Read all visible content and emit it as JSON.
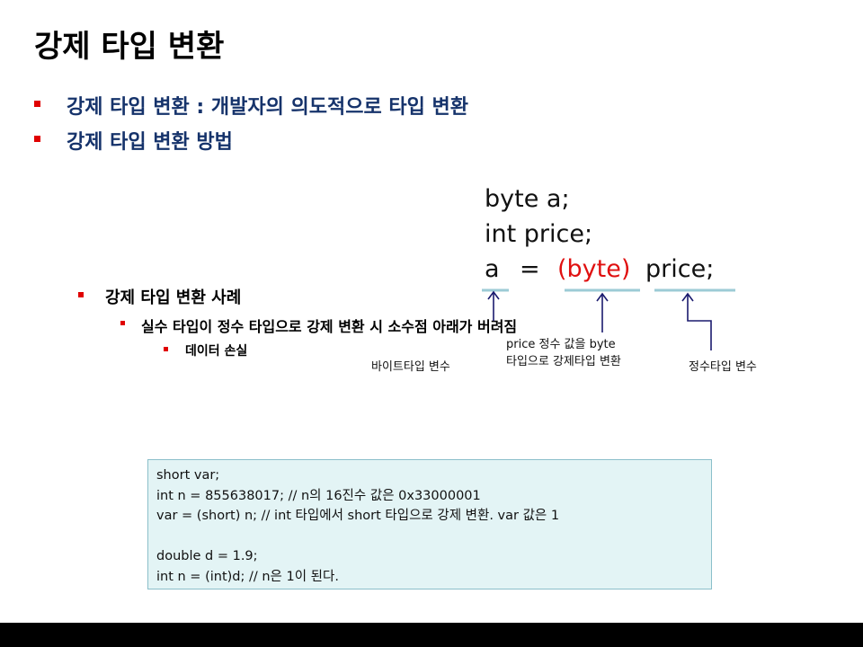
{
  "title": "강제 타입 변환",
  "bullets": [
    "강제 타입 변환 : 개발자의 의도적으로 타입 변환",
    "강제 타입 변환 방법"
  ],
  "subsection": {
    "heading": "강제 타입 변환 사례",
    "item": "실수 타입이 정수 타입으로 강제 변환 시 소수점 아래가 버려짐",
    "subitem": "데이터 손실"
  },
  "diagram": {
    "line1": "byte a;",
    "line2": "int price;",
    "line3_var": "a",
    "line3_eq": "=",
    "line3_cast": "(byte)",
    "line3_rest": "price;",
    "label_byte_var": "바이트타입 변수",
    "label_cast_1": "price 정수 값을 byte",
    "label_cast_2": "타입으로 강제타입 변환",
    "label_int_var": "정수타입 변수",
    "colors": {
      "cast": "#e01010",
      "underline": "#9ccbd6",
      "arrow": "#1a1a6e"
    }
  },
  "code": [
    "short var;",
    "int n = 855638017; // n의 16진수 값은 0x33000001",
    "var = (short) n; // int 타입에서 short 타입으로 강제 변환. var 값은 1",
    "",
    "double d = 1.9;",
    "int n = (int)d; // n은 1이 된다."
  ]
}
